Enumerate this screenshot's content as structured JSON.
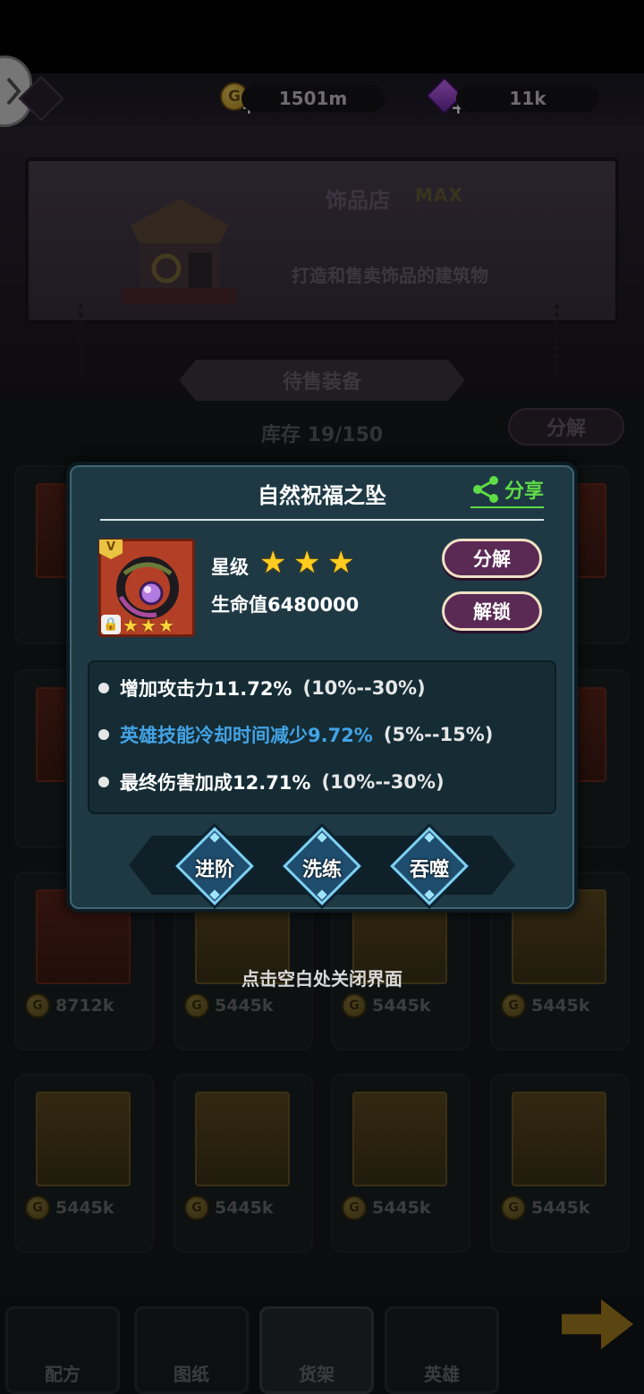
{
  "resources": {
    "gold": "1501m",
    "gems": "11k"
  },
  "shop": {
    "title": "饰品店",
    "level_tag": "MAX",
    "description": "打造和售卖饰品的建筑物"
  },
  "sale_tab": {
    "label": "待售装备"
  },
  "inventory": {
    "text": "库存 19/150"
  },
  "decompose_all": {
    "label": "分解"
  },
  "grid": {
    "items": [
      {
        "price": "8712k",
        "color": "red"
      },
      {
        "price": "5445k",
        "color": "gold"
      },
      {
        "price": "5445k",
        "color": "gold"
      },
      {
        "price": "5445k",
        "color": "gold"
      },
      {
        "price": "5445k",
        "color": "gold"
      },
      {
        "price": "5445k",
        "color": "gold"
      },
      {
        "price": "5445k",
        "color": "gold"
      },
      {
        "price": "5445k",
        "color": "gold"
      }
    ]
  },
  "dialog": {
    "title": "自然祝福之坠",
    "share_label": "分享",
    "tier": "V",
    "star_label": "星级",
    "stars": 3,
    "hp": "生命值6480000",
    "decompose_label": "分解",
    "unlock_label": "解锁",
    "attributes": [
      {
        "text": "增加攻击力11.72%",
        "range": "(10%--30%)",
        "color": "#ffffff"
      },
      {
        "text": "英雄技能冷却时间减少9.72%",
        "range": "(5%--15%)",
        "color": "#43a3e5"
      },
      {
        "text": "最终伤害加成12.71%",
        "range": "(10%--30%)",
        "color": "#ffffff"
      }
    ],
    "actions": [
      "进阶",
      "洗练",
      "吞噬"
    ]
  },
  "close_hint": "点击空白处关闭界面",
  "bottom_nav": {
    "tabs": [
      {
        "label": "配方"
      },
      {
        "label": "图纸"
      },
      {
        "label": "货架"
      },
      {
        "label": "英雄"
      }
    ]
  },
  "colors": {
    "accent_green": "#5fdc47",
    "accent_blue": "#43a3e5",
    "dialog_bg": "#1e3944",
    "button_purple": "#5a2a55"
  }
}
